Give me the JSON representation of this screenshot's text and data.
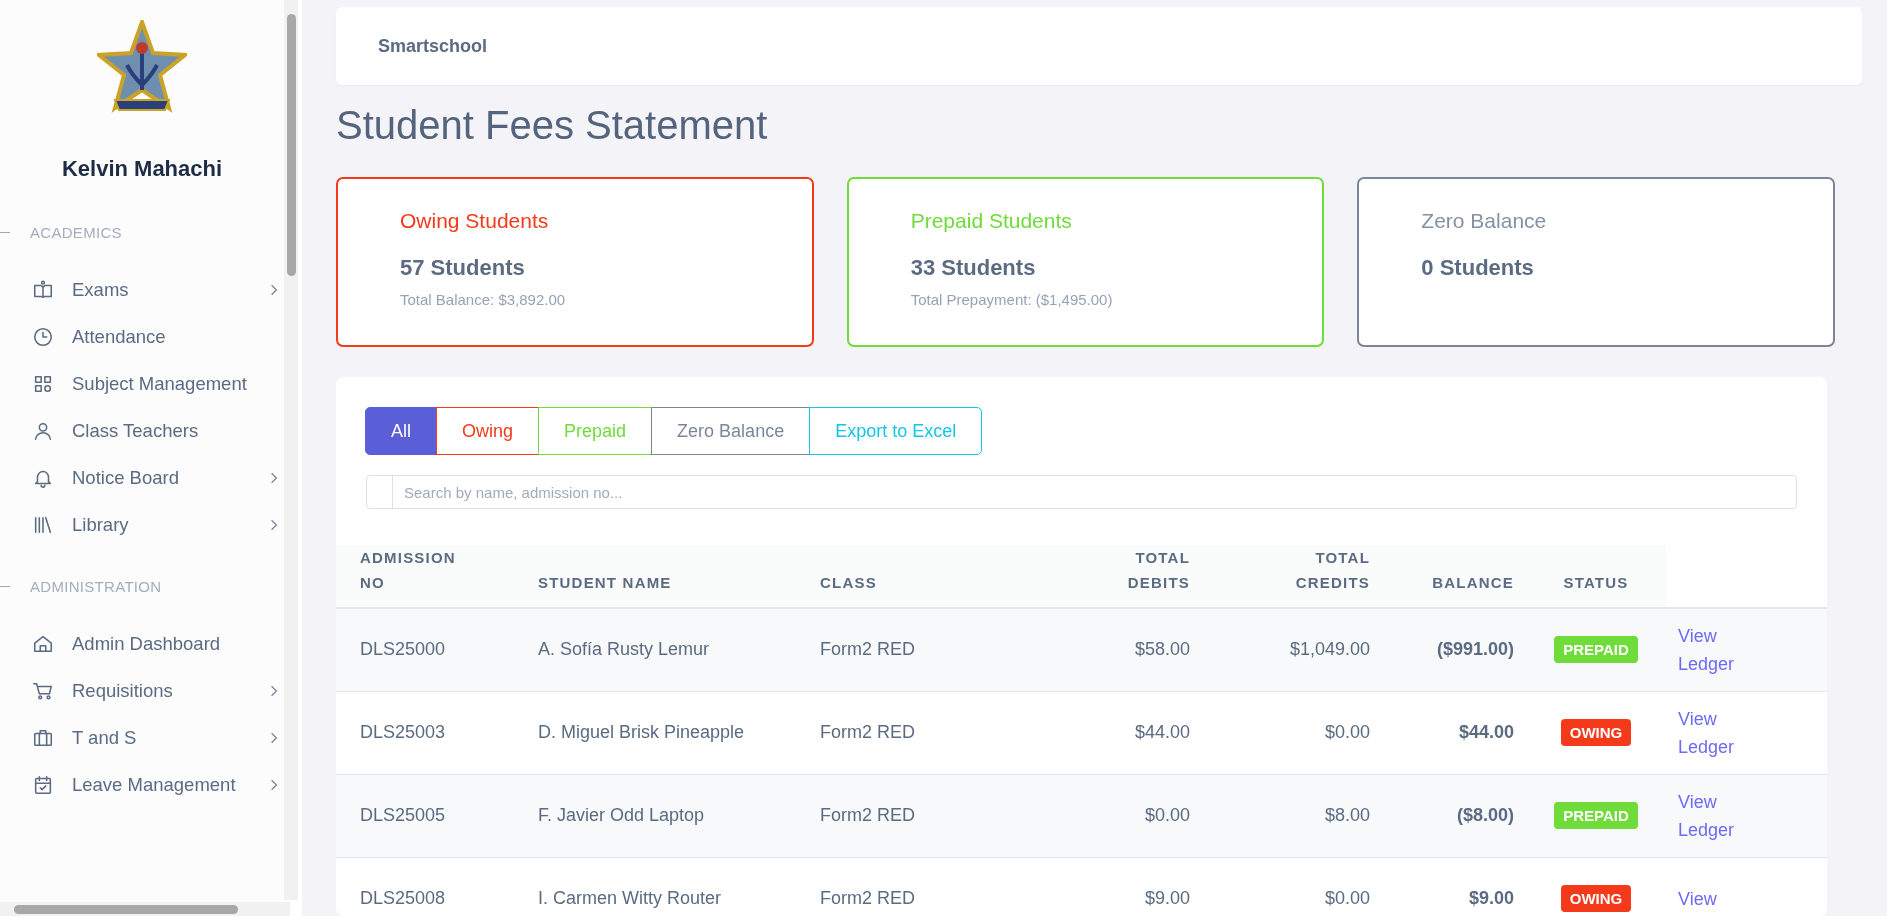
{
  "sidebar": {
    "user_name": "Kelvin Mahachi",
    "sections": [
      {
        "title": "ACADEMICS",
        "items": [
          {
            "label": "Exams",
            "kind": "book",
            "has_submenu": true
          },
          {
            "label": "Attendance",
            "kind": "clock",
            "has_submenu": false
          },
          {
            "label": "Subject Management",
            "kind": "grid",
            "has_submenu": false
          },
          {
            "label": "Class Teachers",
            "kind": "person",
            "has_submenu": false
          },
          {
            "label": "Notice Board",
            "kind": "bell",
            "has_submenu": true
          },
          {
            "label": "Library",
            "kind": "library",
            "has_submenu": true
          }
        ]
      },
      {
        "title": "ADMINISTRATION",
        "items": [
          {
            "label": "Admin Dashboard",
            "kind": "home",
            "has_submenu": false
          },
          {
            "label": "Requisitions",
            "kind": "cart",
            "has_submenu": true
          },
          {
            "label": "T and S",
            "kind": "briefcase",
            "has_submenu": true
          },
          {
            "label": "Leave Management",
            "kind": "calendar",
            "has_submenu": true
          }
        ]
      }
    ]
  },
  "top_bar": {
    "brand": "Smartschool"
  },
  "page_title": "Student Fees Statement",
  "summary_cards": [
    {
      "kind": "owing",
      "title": "Owing Students",
      "count": "57 Students",
      "detail": "Total Balance: $3,892.00"
    },
    {
      "kind": "prepaid",
      "title": "Prepaid Students",
      "count": "33 Students",
      "detail": "Total Prepayment: ($1,495.00)"
    },
    {
      "kind": "zero",
      "title": "Zero Balance",
      "count": "0 Students"
    }
  ],
  "filters": [
    {
      "kind": "all",
      "label": "All",
      "selected": true
    },
    {
      "kind": "owing",
      "label": "Owing",
      "selected": false
    },
    {
      "kind": "prepaid",
      "label": "Prepaid",
      "selected": false
    },
    {
      "kind": "zero",
      "label": "Zero Balance",
      "selected": false
    },
    {
      "kind": "export",
      "label": "Export to Excel",
      "selected": false
    }
  ],
  "search": {
    "placeholder": "Search by name, admission no..."
  },
  "table": {
    "columns": [
      [
        "ADMISSION",
        "NO"
      ],
      [
        "STUDENT NAME"
      ],
      [
        "CLASS"
      ],
      [
        "TOTAL",
        "DEBITS"
      ],
      [
        "TOTAL",
        "CREDITS"
      ],
      [
        "BALANCE"
      ],
      [
        "STATUS"
      ]
    ],
    "rows": [
      {
        "admission_no": "DLS25000",
        "student_name": "A. Sofía Rusty Lemur",
        "class": "Form2 RED",
        "total_debits": "$58.00",
        "total_credits": "$1,049.00",
        "balance": "($991.00)",
        "status": {
          "kind": "prepaid",
          "label": "PREPAID"
        },
        "action": [
          "View",
          "Ledger"
        ]
      },
      {
        "admission_no": "DLS25003",
        "student_name": "D. Miguel Brisk Pineapple",
        "class": "Form2 RED",
        "total_debits": "$44.00",
        "total_credits": "$0.00",
        "balance": "$44.00",
        "status": {
          "kind": "owing",
          "label": "OWING"
        },
        "action": [
          "View",
          "Ledger"
        ]
      },
      {
        "admission_no": "DLS25005",
        "student_name": "F. Javier Odd Laptop",
        "class": "Form2 RED",
        "total_debits": "$0.00",
        "total_credits": "$8.00",
        "balance": "($8.00)",
        "status": {
          "kind": "prepaid",
          "label": "PREPAID"
        },
        "action": [
          "View",
          "Ledger"
        ]
      },
      {
        "admission_no": "DLS25008",
        "student_name": "I. Carmen Witty Router",
        "class": "Form2 RED",
        "total_debits": "$9.00",
        "total_credits": "$0.00",
        "balance": "$9.00",
        "status": {
          "kind": "owing",
          "label": "OWING"
        },
        "action": [
          "View"
        ]
      }
    ]
  }
}
